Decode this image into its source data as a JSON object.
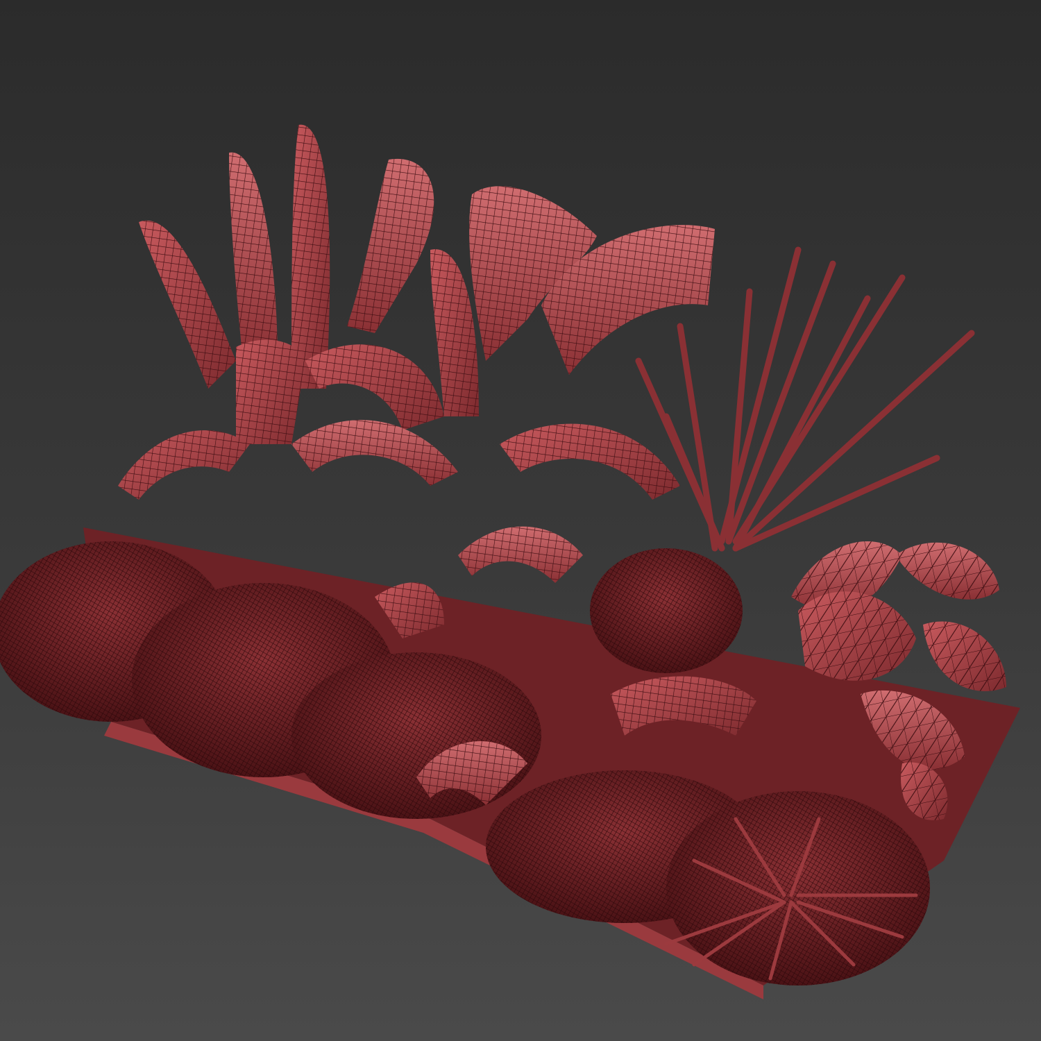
{
  "viewport": {
    "background_top": "#2b2b2b",
    "background_bottom": "#4a4a4a"
  },
  "render": {
    "mode": "wireframe-over-shaded",
    "mesh_color": "#b8444a",
    "mesh_light": "#d0676a",
    "mesh_dark": "#5a1a1e",
    "wire_color": "#3a0c10"
  },
  "model": {
    "subject": "planter-bed",
    "icon": "3d-mesh-icon"
  }
}
